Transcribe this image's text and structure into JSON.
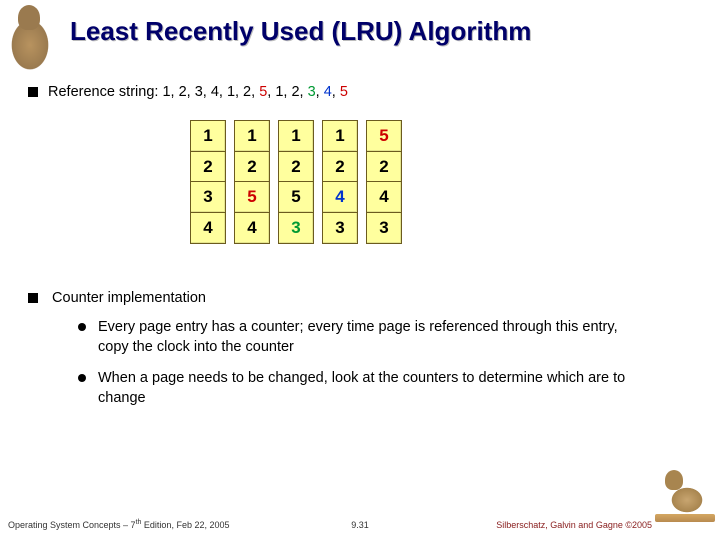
{
  "title": "Least Recently Used (LRU) Algorithm",
  "ref_label": "Reference string:  ",
  "ref_plain": "1, 2, 3, 4, 1, 2, ",
  "ref_r1": "5",
  "ref_mid1": ", 1, 2, ",
  "ref_g1": "3",
  "ref_mid2": ", ",
  "ref_b1": "4",
  "ref_mid3": ", ",
  "ref_r2": "5",
  "frames": [
    {
      "cells": [
        {
          "v": "1"
        },
        {
          "v": "2"
        },
        {
          "v": "3"
        },
        {
          "v": "4"
        }
      ]
    },
    {
      "cells": [
        {
          "v": "1"
        },
        {
          "v": "2"
        },
        {
          "v": "5",
          "c": "red"
        },
        {
          "v": "4"
        }
      ]
    },
    {
      "cells": [
        {
          "v": "1"
        },
        {
          "v": "2"
        },
        {
          "v": "5"
        },
        {
          "v": "3",
          "c": "green"
        }
      ]
    },
    {
      "cells": [
        {
          "v": "1"
        },
        {
          "v": "2"
        },
        {
          "v": "4",
          "c": "blue"
        },
        {
          "v": "3"
        }
      ]
    },
    {
      "cells": [
        {
          "v": "5",
          "c": "red"
        },
        {
          "v": "2"
        },
        {
          "v": "4"
        },
        {
          "v": "3"
        }
      ]
    }
  ],
  "bullet2": "Counter implementation",
  "sub1": "Every page entry has a counter; every time page is referenced through this entry, copy the clock into the counter",
  "sub2": "When a page needs to be changed, look at the counters to determine which are to change",
  "footer_left_a": "Operating System Concepts – 7",
  "footer_left_sup": "th",
  "footer_left_b": " Edition, Feb 22, 2005",
  "footer_center": "9.31",
  "footer_right": "Silberschatz, Galvin and Gagne ©2005"
}
